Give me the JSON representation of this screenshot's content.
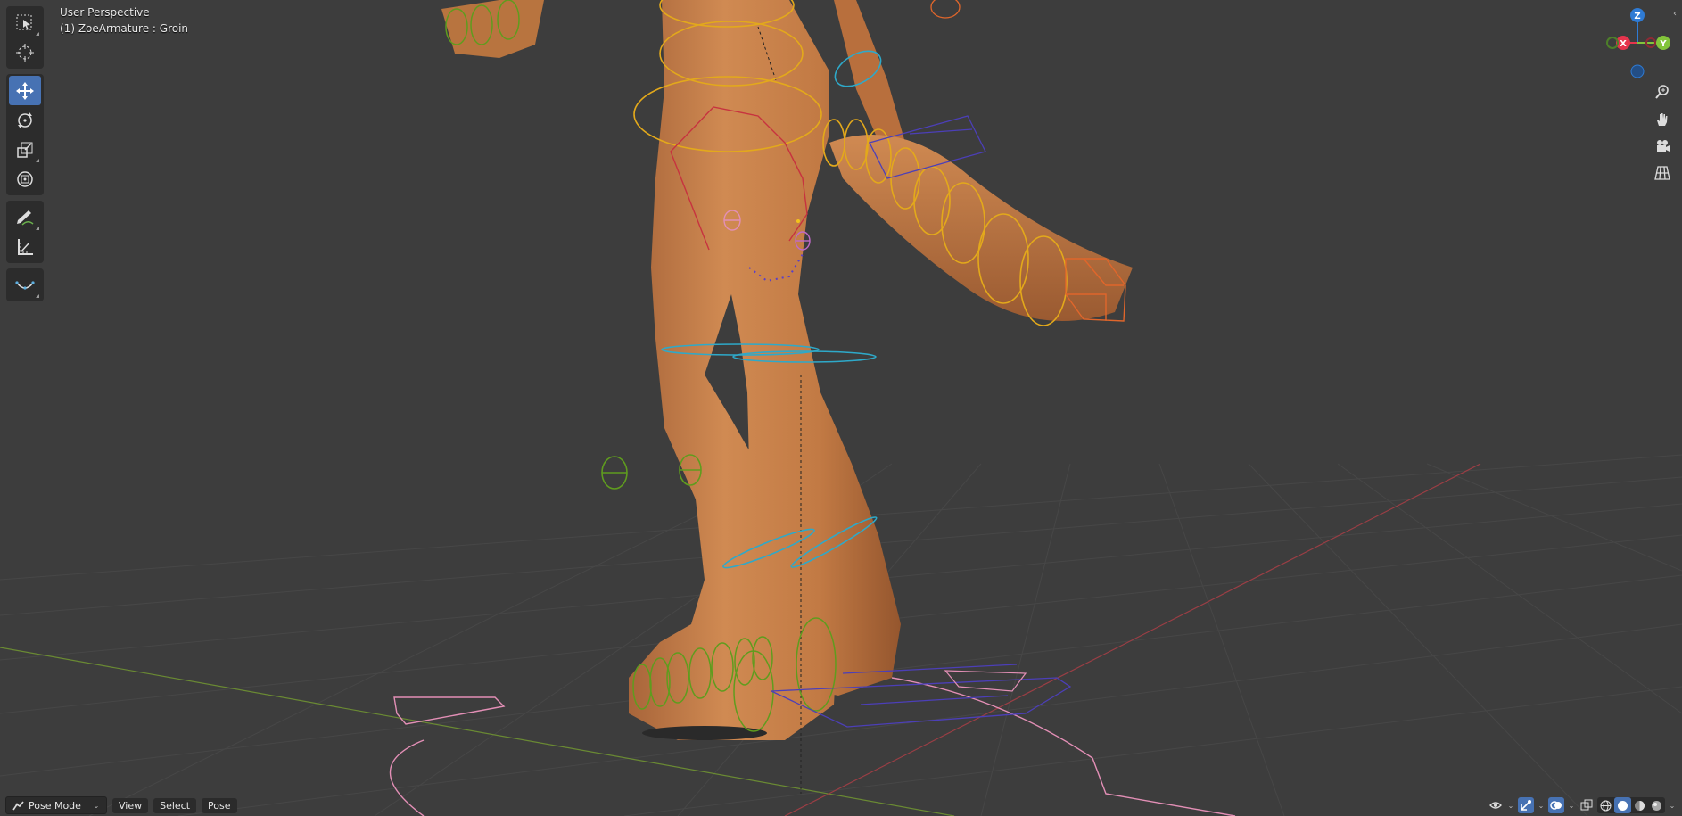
{
  "viewport": {
    "view_name": "User Perspective",
    "object_info": "(1) ZoeArmature : Groin"
  },
  "toolbar": {
    "tools": [
      {
        "name": "select-box",
        "icon": "select-box-icon",
        "active": false
      },
      {
        "name": "cursor",
        "icon": "cursor-icon",
        "active": false
      },
      {
        "name": "move",
        "icon": "move-icon",
        "active": true
      },
      {
        "name": "rotate",
        "icon": "rotate-icon",
        "active": false
      },
      {
        "name": "scale",
        "icon": "scale-icon",
        "active": false
      },
      {
        "name": "transform",
        "icon": "transform-icon",
        "active": false
      },
      {
        "name": "annotate",
        "icon": "annotate-icon",
        "active": false
      },
      {
        "name": "measure",
        "icon": "measure-icon",
        "active": false
      },
      {
        "name": "relax",
        "icon": "relax-icon",
        "active": false
      }
    ]
  },
  "gizmo": {
    "axis_z": "Z",
    "axis_x": "X",
    "axis_y": "Y",
    "colors": {
      "x": "#e6344d",
      "y": "#82c43a",
      "z": "#2f7bd4"
    }
  },
  "navigation": [
    "zoom-icon",
    "pan-hand-icon",
    "camera-icon",
    "ortho-grid-icon"
  ],
  "header": {
    "mode": "Pose Mode",
    "menus": [
      "View",
      "Select",
      "Pose"
    ]
  },
  "colors": {
    "background": "#3d3d3d",
    "grid": "#474747",
    "skin": "#c97f47",
    "bone_yellow": "#e3a91b",
    "bone_green": "#5f9c1e",
    "bone_cyan": "#2ea9c9",
    "bone_pink": "#e38fb6",
    "bone_red": "#c7333f",
    "bone_orange": "#e0662b",
    "bone_blue": "#4c3fb8",
    "accent": "#4772b3"
  }
}
